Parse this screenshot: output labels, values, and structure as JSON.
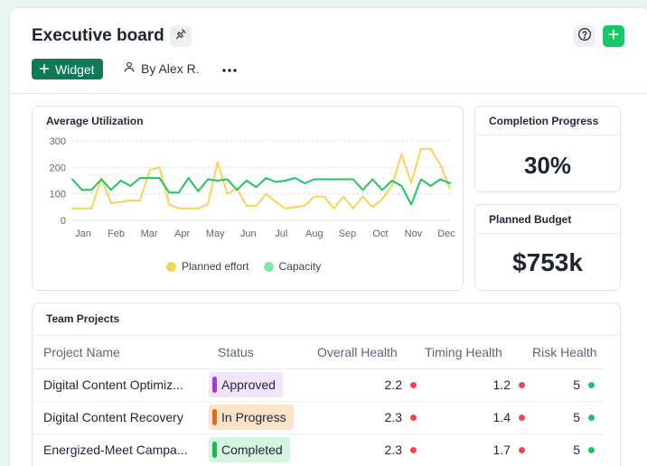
{
  "header": {
    "title": "Executive board",
    "widget_label": "Widget",
    "owner_label": "By Alex R."
  },
  "icons": {
    "pin": "pin-icon",
    "help": "help-icon",
    "add": "plus-icon",
    "user": "user-icon",
    "more": "more-horizontal-icon"
  },
  "colors": {
    "accent": "#0f7a5a",
    "add_button": "#17c964",
    "planned_effort": "#f5d35c",
    "capacity": "#22c55e",
    "health_red": "#ef4452",
    "health_green": "#19c463"
  },
  "utilization": {
    "title": "Average Utilization",
    "chart_data": {
      "type": "line",
      "x_labels": [
        "Jan",
        "Feb",
        "Mar",
        "Apr",
        "May",
        "Jun",
        "Jul",
        "Aug",
        "Sep",
        "Oct",
        "Nov",
        "Dec"
      ],
      "y_ticks": [
        0,
        100,
        200,
        300
      ],
      "ylim": [
        0,
        300
      ],
      "grid": true,
      "legend_placement": "bottom",
      "series": [
        {
          "name": "Planned effort",
          "color": "#f5d35c",
          "values": [
            45,
            45,
            45,
            160,
            65,
            70,
            75,
            75,
            190,
            200,
            60,
            45,
            45,
            45,
            60,
            220,
            100,
            120,
            55,
            55,
            100,
            70,
            45,
            50,
            55,
            90,
            90,
            45,
            90,
            45,
            90,
            50,
            80,
            130,
            250,
            140,
            270,
            270,
            210,
            120
          ]
        },
        {
          "name": "Capacity",
          "color": "#22c55e",
          "values": [
            155,
            115,
            115,
            155,
            115,
            150,
            130,
            160,
            160,
            160,
            105,
            105,
            160,
            110,
            155,
            150,
            155,
            115,
            150,
            125,
            160,
            145,
            150,
            160,
            140,
            155,
            155,
            155,
            155,
            155,
            115,
            155,
            115,
            150,
            130,
            60,
            155,
            130,
            155,
            140
          ]
        }
      ]
    }
  },
  "completion": {
    "title": "Completion Progress",
    "value": "30%"
  },
  "budget": {
    "title": "Planned Budget",
    "value": "$753k"
  },
  "projects": {
    "title": "Team Projects",
    "columns": [
      "Project Name",
      "Status",
      "Overall Health",
      "Timing Health",
      "Risk Health"
    ],
    "rows": [
      {
        "name": "Digital Content Optimiz...",
        "status": "Approved",
        "status_bg": "#f1e4fb",
        "status_bar": "#a238dc",
        "overall": "2.2",
        "overall_color": "#ef4452",
        "timing": "1.2",
        "timing_color": "#ef4452",
        "risk": "5",
        "risk_color": "#19c463"
      },
      {
        "name": "Digital Content Recovery",
        "status": "In Progress",
        "status_bg": "#fde4c8",
        "status_bar": "#e36d14",
        "overall": "2.3",
        "overall_color": "#ef4452",
        "timing": "1.4",
        "timing_color": "#ef4452",
        "risk": "5",
        "risk_color": "#19c463"
      },
      {
        "name": "Energized-Meet Campa...",
        "status": "Completed",
        "status_bg": "#d5f5e0",
        "status_bar": "#19b954",
        "overall": "2.3",
        "overall_color": "#ef4452",
        "timing": "1.7",
        "timing_color": "#ef4452",
        "risk": "5",
        "risk_color": "#19c463"
      }
    ]
  }
}
